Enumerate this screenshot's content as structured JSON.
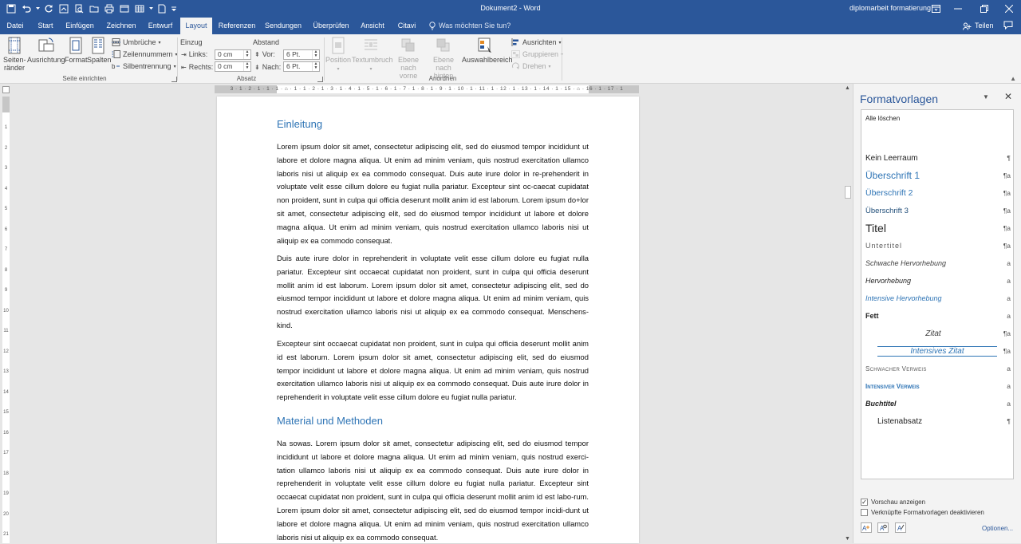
{
  "window": {
    "title": "Dokument2 - Word",
    "user": "diplomarbeit formatierung"
  },
  "tabs": [
    {
      "label": "Datei"
    },
    {
      "label": "Start"
    },
    {
      "label": "Einfügen"
    },
    {
      "label": "Zeichnen"
    },
    {
      "label": "Entwurf"
    },
    {
      "label": "Layout"
    },
    {
      "label": "Referenzen"
    },
    {
      "label": "Sendungen"
    },
    {
      "label": "Überprüfen"
    },
    {
      "label": "Ansicht"
    },
    {
      "label": "Citavi"
    }
  ],
  "tell_me": "Was möchten Sie tun?",
  "share": "Teilen",
  "ribbon": {
    "seite": {
      "seitenraender": "Seiten-\nränder",
      "ausrichtung": "Ausrichtung",
      "format": "Format",
      "spalten": "Spalten",
      "umbrueche": "Umbrüche",
      "zeilennummern": "Zeilennummern",
      "silbentrennung": "Silbentrennung",
      "group_label": "Seite einrichten"
    },
    "absatz": {
      "einzug": "Einzug",
      "abstand": "Abstand",
      "links_label": "Links:",
      "links_value": "0 cm",
      "rechts_label": "Rechts:",
      "rechts_value": "0 cm",
      "vor_label": "Vor:",
      "vor_value": "6 Pt.",
      "nach_label": "Nach:",
      "nach_value": "6 Pt.",
      "group_label": "Absatz"
    },
    "anordnen": {
      "position": "Position",
      "textumbruch": "Textumbruch",
      "nach_vorne": "Ebene nach\nvorne",
      "nach_hinten": "Ebene nach\nhinten",
      "auswahlbereich": "Auswahlbereich",
      "ausrichten": "Ausrichten",
      "gruppieren": "Gruppieren",
      "drehen": "Drehen",
      "group_label": "Anordnen"
    }
  },
  "ruler": {
    "h_labels": "3 · 1 · 2 · 1 · 1 · 1 · ⌂ · 1 · 1 · 2 · 1 · 3 · 1 · 4 · 1 · 5 · 1 · 6 · 1 · 7 · 1 · 8 · 1 · 9 · 1 · 10 · 1 · 11 · 1 · 12 · 1 · 13 · 1 · 14 · 1 · 15 · ⌂ · 16 · 1 · 17 · 1",
    "v_labels": [
      "1",
      "2",
      "3",
      "4",
      "5",
      "6",
      "7",
      "8",
      "9",
      "10",
      "11",
      "12",
      "13",
      "14",
      "15",
      "16",
      "17",
      "18",
      "19",
      "20",
      "21"
    ]
  },
  "document": {
    "h1_einleitung": "Einleitung",
    "p1": "Lorem ipsum dolor sit amet, consectetur adipiscing elit, sed do eiusmod tempor incididunt ut labore et dolore magna aliqua. Ut enim ad minim veniam, quis nostrud exercitation ullamco laboris nisi ut aliquip ex ea commodo consequat. Duis aute irure dolor in re-prehenderit in voluptate velit esse cillum dolore eu fugiat nulla pariatur. Excepteur sint oc-caecat cupidatat non proident, sunt in culpa qui officia deserunt mollit anim id est laborum. Lorem ipsum do+lor sit amet, consectetur adipiscing elit, sed do eiusmod tempor incididunt ut labore et dolore magna aliqua. Ut enim ad minim veniam, quis nostrud exercitation ullamco laboris nisi ut aliquip ex ea commodo consequat.",
    "p2": "Duis aute irure dolor in reprehenderit in voluptate velit esse cillum dolore eu fugiat nulla pariatur. Excepteur sint occaecat cupidatat non proident, sunt in culpa qui officia deserunt mollit anim id est laborum. Lorem ipsum dolor sit amet, consectetur adipiscing elit, sed do eiusmod tempor incididunt ut labore et dolore magna aliqua. Ut enim ad minim veniam, quis nostrud exercitation ullamco laboris nisi ut aliquip ex ea commodo consequat. Menschens-kind.",
    "p3": "Excepteur sint occaecat cupidatat non proident, sunt in culpa qui officia deserunt mollit anim id est laborum. Lorem ipsum dolor sit amet, consectetur adipiscing elit, sed do eiusmod tempor incididunt ut labore et dolore magna aliqua. Ut enim ad minim veniam, quis nostrud exercitation ullamco laboris nisi ut aliquip ex ea commodo consequat. Duis aute irure dolor in reprehenderit in voluptate velit esse cillum dolore eu fugiat nulla pariatur.",
    "h1_material": "Material und Methoden",
    "p4": "Na sowas. Lorem ipsum dolor sit amet, consectetur adipiscing elit, sed do eiusmod tempor incididunt ut labore et dolore magna aliqua. Ut enim ad minim veniam, quis nostrud exerci-tation ullamco laboris nisi ut aliquip ex ea commodo consequat. Duis aute irure dolor in reprehenderit in voluptate velit esse cillum dolore eu fugiat nulla pariatur. Excepteur sint occaecat cupidatat non proident, sunt in culpa qui officia deserunt mollit anim id est labo-rum. Lorem ipsum dolor sit amet, consectetur adipiscing elit, sed do eiusmod tempor incidi-dunt ut labore et dolore magna aliqua. Ut enim ad minim veniam, quis nostrud exercitation ullamco laboris nisi ut aliquip ex ea commodo consequat."
  },
  "styles_pane": {
    "title": "Formatvorlagen",
    "clear_all": "Alle löschen",
    "styles": [
      {
        "name": "Kein Leerraum",
        "marker": "¶"
      },
      {
        "name": "Überschrift 1",
        "marker": "¶a"
      },
      {
        "name": "Überschrift 2",
        "marker": "¶a"
      },
      {
        "name": "Überschrift 3",
        "marker": "¶a"
      },
      {
        "name": "Titel",
        "marker": "¶a"
      },
      {
        "name": "Untertitel",
        "marker": "¶a"
      },
      {
        "name": "Schwache Hervorhebung",
        "marker": "a"
      },
      {
        "name": "Hervorhebung",
        "marker": "a"
      },
      {
        "name": "Intensive Hervorhebung",
        "marker": "a"
      },
      {
        "name": "Fett",
        "marker": "a"
      },
      {
        "name": "Zitat",
        "marker": "¶a"
      },
      {
        "name": "Intensives Zitat",
        "marker": "¶a"
      },
      {
        "name": "Schwacher Verweis",
        "marker": "a"
      },
      {
        "name": "Intensiver Verweis",
        "marker": "a"
      },
      {
        "name": "Buchtitel",
        "marker": "a"
      },
      {
        "name": "Listenabsatz",
        "marker": "¶"
      }
    ],
    "preview_label": "Vorschau anzeigen",
    "preview_checked": true,
    "linked_label": "Verknüpfte Formatvorlagen deaktivieren",
    "linked_checked": false,
    "options": "Optionen..."
  },
  "colors": {
    "brand": "#2b579a",
    "heading": "#2e74b5"
  }
}
